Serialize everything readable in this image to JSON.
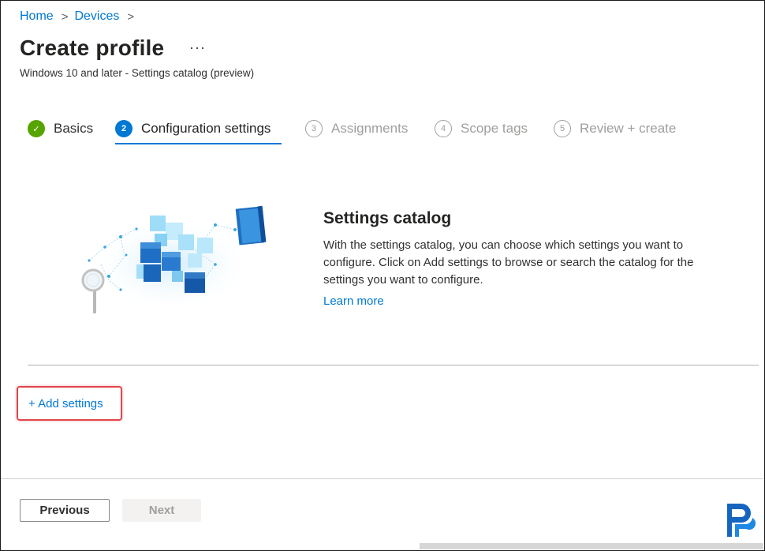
{
  "breadcrumb": {
    "home": "Home",
    "devices": "Devices",
    "sep": ">"
  },
  "page": {
    "title": "Create profile",
    "more": "···",
    "subtitle": "Windows 10 and later - Settings catalog (preview)"
  },
  "steps": [
    {
      "number": "✓",
      "label": "Basics",
      "state": "done"
    },
    {
      "number": "2",
      "label": "Configuration settings",
      "state": "active"
    },
    {
      "number": "3",
      "label": "Assignments",
      "state": "pending"
    },
    {
      "number": "4",
      "label": "Scope tags",
      "state": "pending"
    },
    {
      "number": "5",
      "label": "Review + create",
      "state": "pending"
    }
  ],
  "catalog": {
    "title": "Settings catalog",
    "description": "With the settings catalog, you can choose which settings you want to configure. Click on Add settings to browse or search the catalog for the settings you want to configure.",
    "learn_more": "Learn more"
  },
  "add_settings": "+ Add settings",
  "footer": {
    "previous": "Previous",
    "next": "Next"
  },
  "colors": {
    "accent": "#0078d4",
    "done": "#57a300",
    "highlight": "#e0474c",
    "logo": "#1565c0"
  }
}
